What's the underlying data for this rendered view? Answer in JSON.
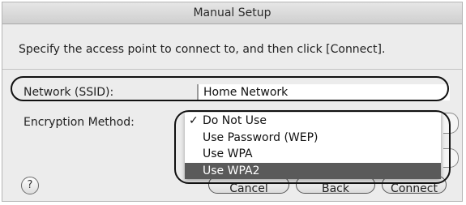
{
  "dialog": {
    "title": "Manual Setup",
    "instruction": "Specify the access point to connect to, and then click [Connect]."
  },
  "form": {
    "ssid_label": "Network (SSID):",
    "ssid_value": "Home Network",
    "encryption_label": "Encryption Method:"
  },
  "encryption_menu": {
    "items": [
      {
        "label": "Do Not Use",
        "checked": true,
        "highlighted": false
      },
      {
        "label": "Use Password (WEP)",
        "checked": false,
        "highlighted": false
      },
      {
        "label": "Use WPA",
        "checked": false,
        "highlighted": false
      },
      {
        "label": "Use WPA2",
        "checked": false,
        "highlighted": true
      }
    ],
    "check_mark": "✓"
  },
  "buttons": {
    "help": "?",
    "cancel": "Cancel",
    "back": "Back",
    "connect": "Connect"
  },
  "colors": {
    "highlight": "#5a5a5a",
    "dialog_bg": "#ececec",
    "annotation_outline": "#111111"
  }
}
